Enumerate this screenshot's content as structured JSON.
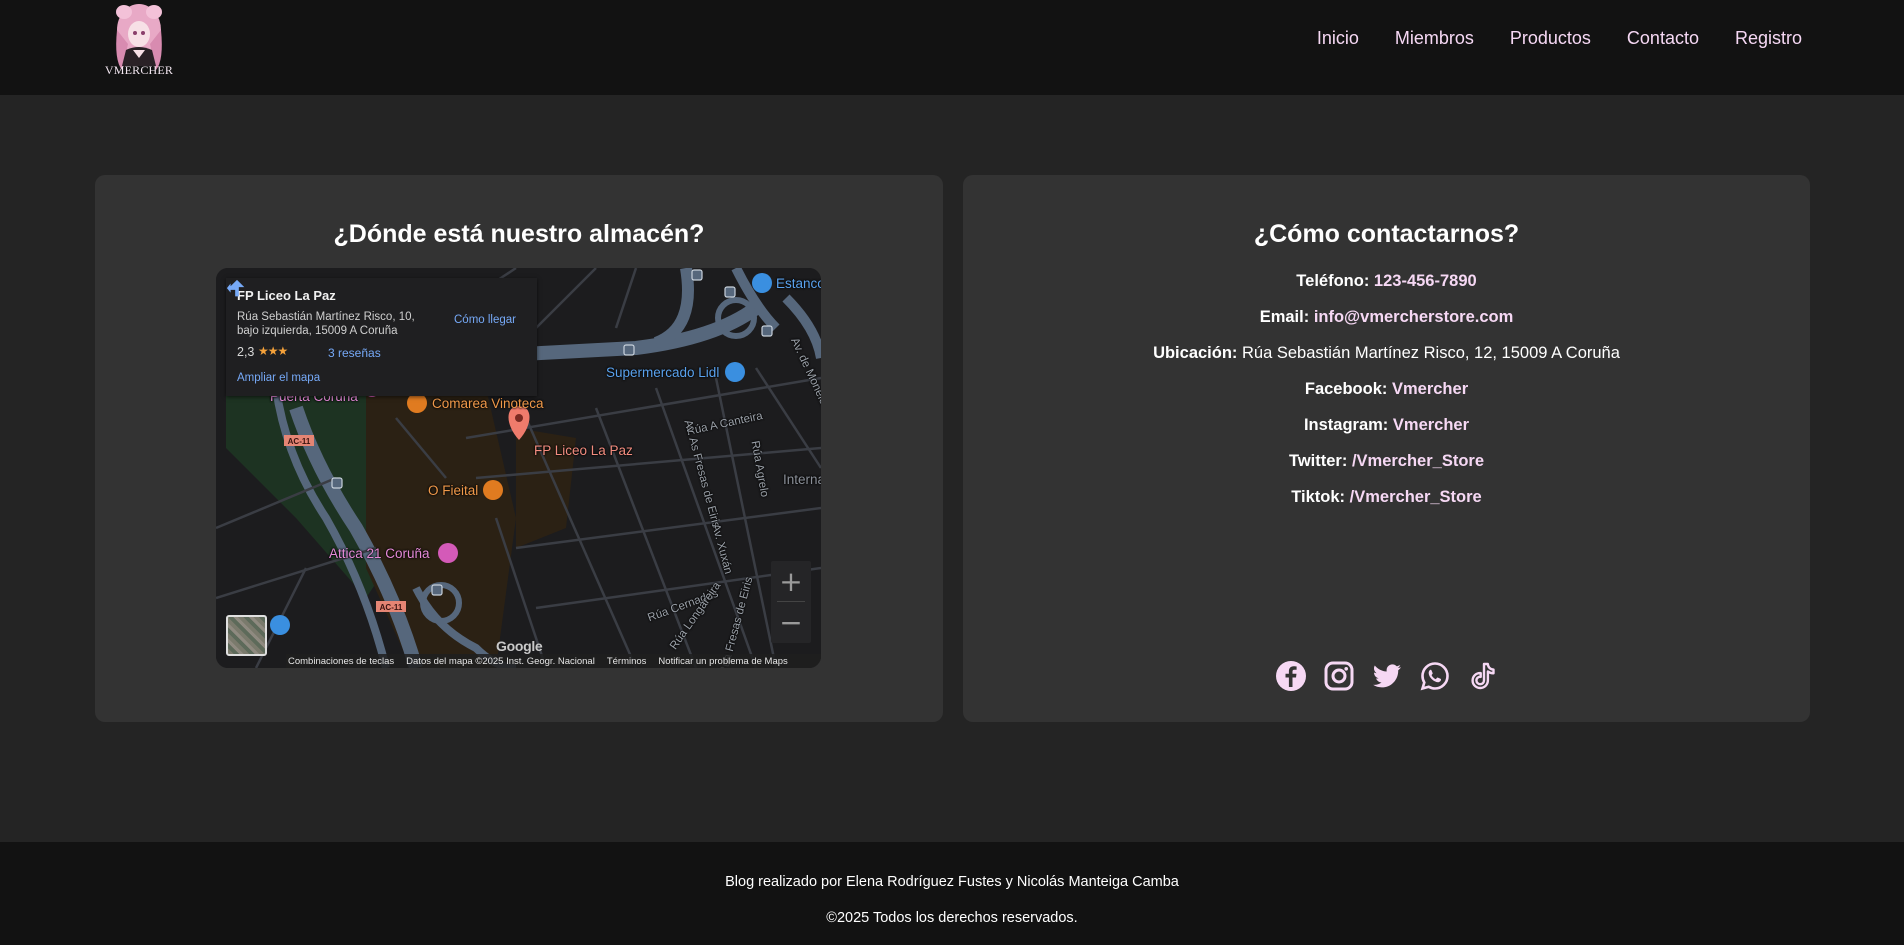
{
  "brand": {
    "logo_text": "VMERCHER"
  },
  "nav": [
    "Inicio",
    "Miembros",
    "Productos",
    "Contacto",
    "Registro"
  ],
  "warehouse": {
    "title": "¿Dónde está nuestro almacén?",
    "map": {
      "place_name": "FP Liceo La Paz",
      "address": "Rúa Sebastián Martínez Risco, 10, bajo izquierda, 15009 A Coruña",
      "rating": "2,3",
      "stars": "★★★",
      "reviews": "3 reseñas",
      "directions": "Cómo llegar",
      "enlarge": "Ampliar el mapa",
      "labels": {
        "puerta_coruna": "Puerta Coruña",
        "comarea": "Comarea Vinoteca",
        "supermercado": "Supermercado Lidl",
        "estanco": "Estanco",
        "fp_liceo": "FP Liceo La Paz",
        "o_fieital": "O Fieital",
        "attica": "Attica 21 Coruña",
        "interna": "Interna",
        "rua_canteira": "Rúa A Canteira",
        "av_fresas": "Av. As Fresas de Eiris",
        "rua_agrelo": "Rúa Agrelo",
        "av_xuxan": "Av. Xuxán",
        "rua_cernadas": "Rúa Cernadas",
        "rua_longareira": "Rúa Longareira",
        "rua_fresas": "Rúa Fresas de Eiris",
        "av_de_monelos": "Av. de Monelos",
        "ac11": "AC-11"
      },
      "google": "Google",
      "footer": [
        "Combinaciones de teclas",
        "Datos del mapa ©2025 Inst. Geogr. Nacional",
        "Términos",
        "Notificar un problema de Maps"
      ]
    }
  },
  "contact": {
    "title": "¿Cómo contactarnos?",
    "rows": [
      {
        "label": "Teléfono:",
        "value": "123-456-7890"
      },
      {
        "label": "Email:",
        "value": "info@vmercherstore.com"
      },
      {
        "label": "Ubicación:",
        "value": "Rúa Sebastián Martínez Risco, 12, 15009 A Coruña"
      },
      {
        "label": "Facebook:",
        "value": "Vmercher"
      },
      {
        "label": "Instagram:",
        "value": "Vmercher"
      },
      {
        "label": "Twitter:",
        "value": "/Vmercher_Store"
      },
      {
        "label": "Tiktok:",
        "value": "/Vmercher_Store"
      }
    ],
    "social_icons": [
      "facebook-icon",
      "instagram-icon",
      "twitter-icon",
      "whatsapp-icon",
      "tiktok-icon"
    ],
    "accent_color": "#f6d8f4"
  },
  "footer": {
    "credit": "Blog realizado por Elena Rodríguez Fustes y Nicolás Manteiga Camba",
    "copyright": "©2025 Todos los derechos reservados."
  }
}
